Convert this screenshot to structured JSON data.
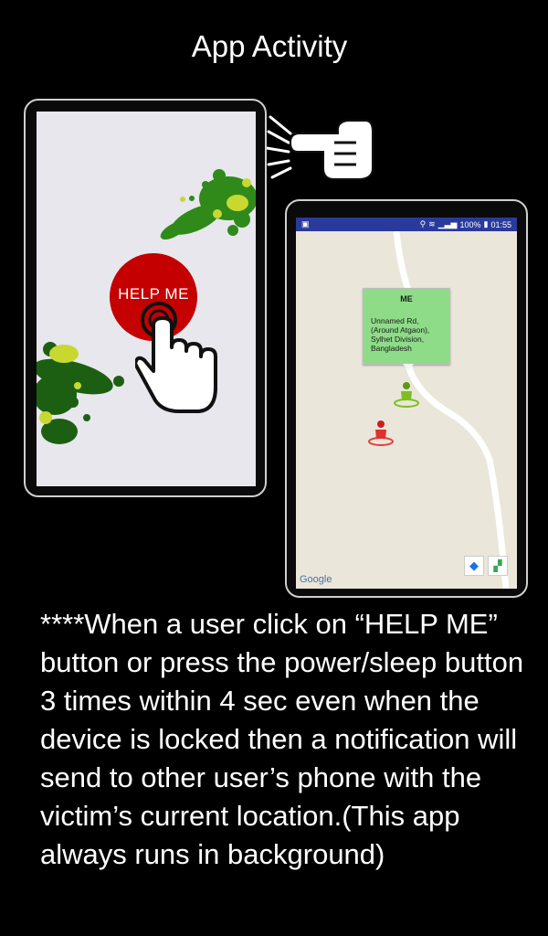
{
  "title": "App Activity",
  "help_phone": {
    "button_label": "HELP ME"
  },
  "map_phone": {
    "status": {
      "battery": "100%",
      "time": "01:55"
    },
    "info_card": {
      "heading": "ME",
      "address_lines": [
        "Unnamed Rd,",
        "(Around Atgaon),",
        "Sylhet Division,",
        "Bangladesh"
      ]
    },
    "google_label": "Google"
  },
  "description": "****When a user click on “HELP ME” button or press the power/sleep button 3 times within 4 sec even when the device is locked then a notification will send to other user’s phone with the victim’s current location.(This app always runs in background)",
  "colors": {
    "help_button": "#c40000",
    "statusbar": "#2a3a9a",
    "info_card": "#8edc88",
    "map_bg": "#ebe6da"
  }
}
